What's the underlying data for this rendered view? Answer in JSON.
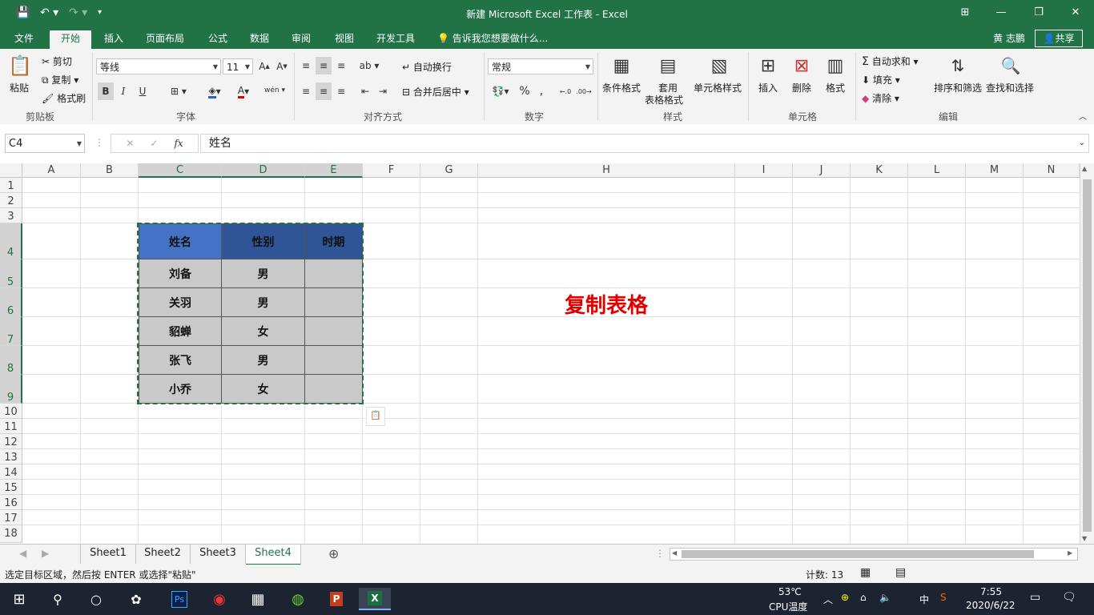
{
  "window": {
    "title": "新建 Microsoft Excel 工作表 - Excel",
    "controls": {
      "ribbon_display": "⊞",
      "minimize": "—",
      "restore": "❐",
      "close": "✕"
    }
  },
  "tabs": [
    "文件",
    "开始",
    "插入",
    "页面布局",
    "公式",
    "数据",
    "审阅",
    "视图",
    "开发工具"
  ],
  "tell_me": "告诉我您想要做什么...",
  "user": "黄 志鹏",
  "share": "共享",
  "ribbon": {
    "clipboard": {
      "paste": "粘贴",
      "cut": "剪切",
      "copy": "复制",
      "format_painter": "格式刷",
      "label": "剪贴板"
    },
    "font": {
      "name": "等线",
      "size": "11",
      "bold": "B",
      "italic": "I",
      "underline": "U",
      "label": "字体"
    },
    "alignment": {
      "wrap": "自动换行",
      "merge": "合并后居中",
      "label": "对齐方式"
    },
    "number": {
      "format": "常规",
      "label": "数字"
    },
    "styles": {
      "conditional": "条件格式",
      "table_fmt_1": "套用",
      "table_fmt_2": "表格格式",
      "cell_styles": "单元格样式",
      "label": "样式"
    },
    "cells": {
      "insert": "插入",
      "delete": "删除",
      "format": "格式",
      "label": "单元格"
    },
    "editing": {
      "autosum": "自动求和",
      "fill": "填充",
      "clear": "清除",
      "sort": "排序和筛选",
      "find": "查找和选择",
      "label": "编辑"
    }
  },
  "formula_bar": {
    "name_box": "C4",
    "value": "姓名"
  },
  "columns": [
    "A",
    "B",
    "C",
    "D",
    "E",
    "F",
    "G",
    "H",
    "I",
    "J",
    "K",
    "L",
    "M",
    "N"
  ],
  "rows": [
    "1",
    "2",
    "3",
    "4",
    "5",
    "6",
    "7",
    "8",
    "9",
    "10",
    "11",
    "12",
    "13",
    "14",
    "15",
    "16",
    "17",
    "18"
  ],
  "table": {
    "headers": [
      "姓名",
      "性别",
      "时期"
    ],
    "rows": [
      [
        "刘备",
        "男",
        ""
      ],
      [
        "关羽",
        "男",
        ""
      ],
      [
        "貂蝉",
        "女",
        ""
      ],
      [
        "张飞",
        "男",
        ""
      ],
      [
        "小乔",
        "女",
        ""
      ]
    ]
  },
  "annotation": "复制表格",
  "sheets": [
    "Sheet1",
    "Sheet2",
    "Sheet3",
    "Sheet4"
  ],
  "status": {
    "message": "选定目标区域，然后按 ENTER 或选择\"粘贴\"",
    "count": "计数: 13"
  },
  "taskbar": {
    "temp": "53℃",
    "temp_label": "CPU温度",
    "ime": "中",
    "time": "7:55",
    "date": "2020/6/22"
  },
  "colors": {
    "accent": "#217346",
    "header_fill": "#4472c4",
    "body_fill": "#c9c9c9",
    "annotation": "#e00000"
  }
}
